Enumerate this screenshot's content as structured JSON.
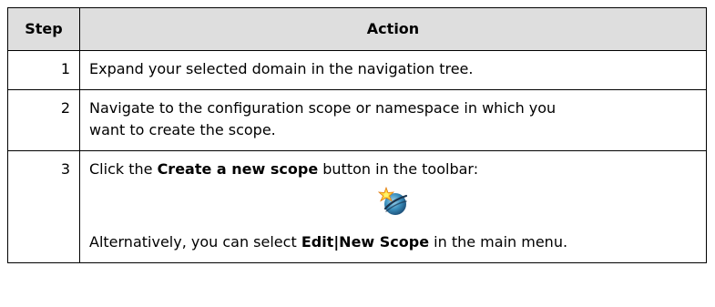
{
  "table": {
    "headers": {
      "step": "Step",
      "action": "Action"
    },
    "rows": [
      {
        "step": "1",
        "action": "Expand your selected domain in the navigation tree."
      },
      {
        "step": "2",
        "action_line1": "Navigate to the configuration scope or namespace in which you",
        "action_line2": "want to create the scope."
      },
      {
        "step": "3",
        "action_pre": "Click the ",
        "action_bold": "Create a new scope",
        "action_post": " button in the toolbar:",
        "icon": "new-scope-icon",
        "alt_pre": "Alternatively, you can select ",
        "alt_bold": "Edit|New Scope",
        "alt_post": " in the main menu."
      }
    ]
  }
}
